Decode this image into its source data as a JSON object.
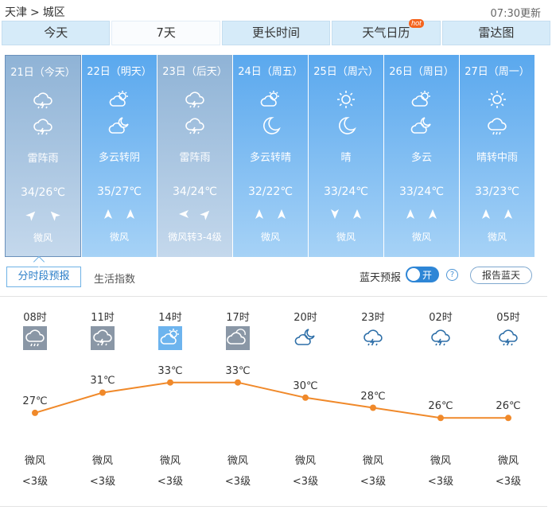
{
  "breadcrumb": {
    "city": "天津",
    "sep": ">",
    "district": "城区"
  },
  "updated": "07:30更新",
  "tabs": [
    {
      "label": "今天"
    },
    {
      "label": "7天"
    },
    {
      "label": "更长时间"
    },
    {
      "label": "天气日历",
      "badge": "hot"
    },
    {
      "label": "雷达图"
    }
  ],
  "days": [
    {
      "name": "21日（今天）",
      "icon1": "thunderstorm-icon",
      "icon2": "thunderstorm-icon",
      "weather": "雷阵雨",
      "temp": "34/26℃",
      "wind": "微风"
    },
    {
      "name": "22日（明天）",
      "icon1": "partly-cloudy-icon",
      "icon2": "cloudy-night-icon",
      "weather": "多云转阴",
      "temp": "35/27℃",
      "wind": "微风"
    },
    {
      "name": "23日（后天）",
      "icon1": "thunderstorm-icon",
      "icon2": "thunderstorm-icon",
      "weather": "雷阵雨",
      "temp": "34/24℃",
      "wind": "微风转3-4级"
    },
    {
      "name": "24日（周五）",
      "icon1": "partly-cloudy-icon",
      "icon2": "moon-icon",
      "weather": "多云转晴",
      "temp": "32/22℃",
      "wind": "微风"
    },
    {
      "name": "25日（周六）",
      "icon1": "sun-icon",
      "icon2": "moon-icon",
      "weather": "晴",
      "temp": "33/24℃",
      "wind": "微风"
    },
    {
      "name": "26日（周日）",
      "icon1": "partly-cloudy-icon",
      "icon2": "cloudy-night-icon",
      "weather": "多云",
      "temp": "33/24℃",
      "wind": "微风"
    },
    {
      "name": "27日（周一）",
      "icon1": "sun-icon",
      "icon2": "rain-icon",
      "weather": "晴转中雨",
      "temp": "33/23℃",
      "wind": "微风"
    }
  ],
  "subtabs": {
    "hourly": "分时段预报",
    "living": "生活指数"
  },
  "bluesky": {
    "label": "蓝天预报",
    "toggle": "开",
    "help": "?",
    "report": "报告蓝天"
  },
  "hourly": [
    {
      "time": "08时",
      "icon": "rain-icon",
      "temp": "27℃",
      "t": 27,
      "wind": "微风",
      "level": "<3级"
    },
    {
      "time": "11时",
      "icon": "thunderstorm-icon",
      "temp": "31℃",
      "t": 31,
      "wind": "微风",
      "level": "<3级"
    },
    {
      "time": "14时",
      "icon": "partly-cloudy-icon",
      "temp": "33℃",
      "t": 33,
      "wind": "微风",
      "level": "<3级"
    },
    {
      "time": "17时",
      "icon": "cloudy-icon",
      "temp": "33℃",
      "t": 33,
      "wind": "微风",
      "level": "<3级"
    },
    {
      "time": "20时",
      "icon": "cloudy-night-icon",
      "temp": "30℃",
      "t": 30,
      "wind": "微风",
      "level": "<3级"
    },
    {
      "time": "23时",
      "icon": "thunderstorm-icon",
      "temp": "28℃",
      "t": 28,
      "wind": "微风",
      "level": "<3级"
    },
    {
      "time": "02时",
      "icon": "thunderstorm-icon",
      "temp": "26℃",
      "t": 26,
      "wind": "微风",
      "level": "<3级"
    },
    {
      "time": "05时",
      "icon": "thunderstorm-icon",
      "temp": "26℃",
      "t": 26,
      "wind": "微风",
      "level": "<3级"
    }
  ],
  "colors": {
    "accent": "#2c7fc8",
    "curve": "#f0892a",
    "tab": "#d6ebf9",
    "dayBlue": "#5aa8ee",
    "dayGray": "#8fb3d6"
  }
}
